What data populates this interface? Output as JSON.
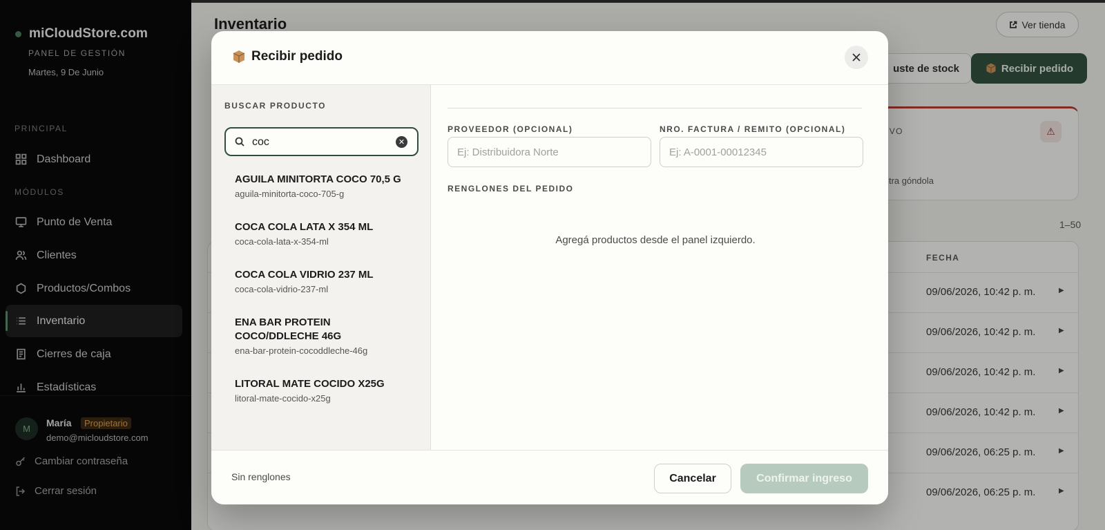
{
  "sidebar": {
    "brand": "miCloudStore.com",
    "panel_label": "PANEL DE GESTIÓN",
    "date": "Martes, 9 De Junio",
    "sections": {
      "principal": "PRINCIPAL",
      "modulos": "MÓDULOS"
    },
    "items": [
      {
        "label": "Dashboard",
        "icon": "grid-icon"
      },
      {
        "label": "Punto de Venta",
        "icon": "monitor-icon"
      },
      {
        "label": "Clientes",
        "icon": "users-icon"
      },
      {
        "label": "Productos/Combos",
        "icon": "hexagon-icon"
      },
      {
        "label": "Inventario",
        "icon": "list-icon",
        "active": true
      },
      {
        "label": "Cierres de caja",
        "icon": "receipt-icon"
      },
      {
        "label": "Estadísticas",
        "icon": "bar-chart-icon"
      }
    ],
    "user": {
      "initial": "M",
      "name": "María",
      "role": "Propietario",
      "email": "demo@micloudstore.com"
    },
    "change_password": "Cambiar contraseña",
    "logout": "Cerrar sesión"
  },
  "main": {
    "title": "Inventario",
    "ver_tienda": "Ver tienda",
    "ajuste_stock": "uste de stock",
    "recibir_pedido": "Recibir pedido",
    "alert_label": "IVO",
    "alert_sub": "contra góndola",
    "range": "1–50",
    "table_header_fecha": "FECHA",
    "rows": [
      "09/06/2026, 10:42 p. m.",
      "09/06/2026, 10:42 p. m.",
      "09/06/2026, 10:42 p. m.",
      "09/06/2026, 10:42 p. m.",
      "09/06/2026, 06:25 p. m.",
      "09/06/2026, 06:25 p. m."
    ]
  },
  "modal": {
    "title": "Recibir pedido",
    "search_label": "BUSCAR PRODUCTO",
    "search_value": "coc",
    "results": [
      {
        "name": "AGUILA MINITORTA COCO 70,5 G",
        "slug": "aguila-minitorta-coco-705-g"
      },
      {
        "name": "COCA COLA LATA X 354 ML",
        "slug": "coca-cola-lata-x-354-ml"
      },
      {
        "name": "COCA COLA VIDRIO 237 ML",
        "slug": "coca-cola-vidrio-237-ml"
      },
      {
        "name": "ENA BAR PROTEIN COCO/DDLECHE 46G",
        "slug": "ena-bar-protein-cocoddleche-46g"
      },
      {
        "name": "LITORAL MATE COCIDO X25G",
        "slug": "litoral-mate-cocido-x25g"
      }
    ],
    "proveedor_label": "PROVEEDOR (OPCIONAL)",
    "proveedor_placeholder": "Ej: Distribuidora Norte",
    "factura_label": "NRO. FACTURA / REMITO (OPCIONAL)",
    "factura_placeholder": "Ej: A-0001-00012345",
    "renglones_label": "RENGLONES DEL PEDIDO",
    "empty_text": "Agregá productos desde el panel izquierdo.",
    "footer_status": "Sin renglones",
    "cancel": "Cancelar",
    "confirm": "Confirmar ingreso"
  },
  "colors": {
    "accent": "#2f4f3c",
    "confirm_disabled": "#b6cbbd",
    "alert": "#b53a2e",
    "role_badge": "#e0a14a"
  }
}
